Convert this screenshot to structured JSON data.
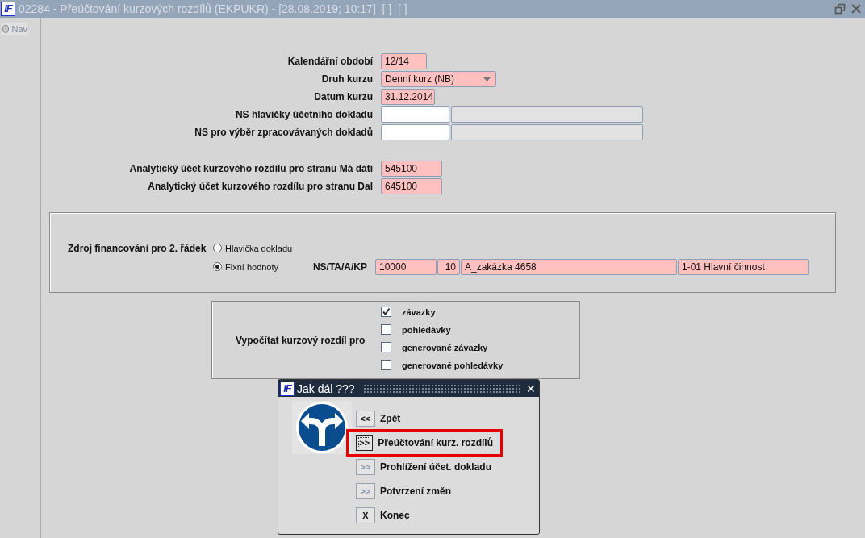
{
  "window": {
    "logo": "IF",
    "title": "02284 - Přeúčtování kurzových rozdílů (EKPUKR) - [28.08.2019; 10:17]  [ ]  [ ]"
  },
  "nav_tab": {
    "label": "Nav",
    "selected": false
  },
  "form_rows": [
    {
      "label": "Kalendářní období",
      "kind": "period",
      "value": "12/14",
      "required": true
    },
    {
      "label": "Druh kurzu",
      "kind": "select",
      "value": "Denní kurz (NB)",
      "required": true
    },
    {
      "label": "Datum kurzu",
      "kind": "date",
      "value": "31.12.2014",
      "required": true
    },
    {
      "label": "NS hlavičky účetního dokladu",
      "kind": "pair",
      "required": false
    },
    {
      "label": "NS pro výběr zpracovávaných dokladů",
      "kind": "pair",
      "required": false
    }
  ],
  "account_rows": [
    {
      "label": "Analytický účet kurzového rozdílu pro stranu Má dáti",
      "value": "545100",
      "required": true
    },
    {
      "label": "Analytický účet kurzového rozdílu pro stranu Dal",
      "value": "645100",
      "required": true
    }
  ],
  "financing": {
    "label": "Zdroj financování pro 2. řádek",
    "options": [
      {
        "label": "Hlavička dokladu",
        "selected": false
      },
      {
        "label": "Fixní hodnoty",
        "selected": true
      }
    ],
    "fixed_label": "NS/TA/A/KP",
    "fixed_values": [
      "10000",
      "10",
      "A_zakázka 4658",
      "1-01 Hlavní činnost"
    ]
  },
  "calculate": {
    "label": "Vypočítat kurzový rozdíl pro",
    "items": [
      {
        "label": "závazky",
        "checked": true
      },
      {
        "label": "pohledávky",
        "checked": false
      },
      {
        "label": "generované závazky",
        "checked": false
      },
      {
        "label": "generované pohledávky",
        "checked": false
      }
    ]
  },
  "dialog": {
    "logo": "IF",
    "title": "Jak dál ???",
    "close": "✕",
    "options": [
      {
        "button": "<<",
        "label": "Zpět",
        "disabled": false,
        "highlighted": false
      },
      {
        "button": ">>",
        "label": "Přeúčtování kurz. rozdílů",
        "disabled": false,
        "highlighted": true
      },
      {
        "button": ">>",
        "label": "Prohlížení účet. dokladu",
        "disabled": true,
        "highlighted": false
      },
      {
        "button": ">>",
        "label": "Potvrzení změn",
        "disabled": true,
        "highlighted": false
      },
      {
        "button": "X",
        "label": "Konec",
        "disabled": false,
        "highlighted": false
      }
    ]
  }
}
